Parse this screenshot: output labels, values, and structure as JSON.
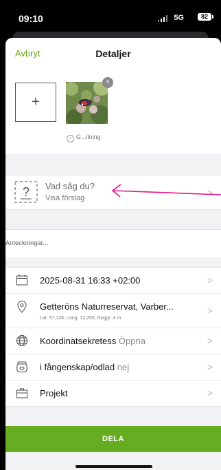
{
  "status_bar": {
    "time": "09:10",
    "network": "5G",
    "battery": "82"
  },
  "header": {
    "cancel_label": "Avbryt",
    "title": "Detaljer"
  },
  "photos": {
    "add_symbol": "+",
    "delete_symbol": "×",
    "caption": "G...llning"
  },
  "species": {
    "prompt": "Vad såg du?",
    "suggestion": "Visa förslag"
  },
  "notes": {
    "placeholder": "Anteckningar..."
  },
  "details": {
    "datetime": "2025-08-31 16:33 +02:00",
    "location": "Getteröns Naturreservat, Varber...",
    "location_coords": "Lat: 57,126, Long: 12,253, Noggr: 4 m",
    "coord_secrecy_label": "Koordinatsekretess",
    "coord_secrecy_value": "Öppna",
    "captivity_label": "i fångenskap/odlad",
    "captivity_value": "nej",
    "project_label": "Projekt"
  },
  "share_label": "DELA",
  "chevron": ">",
  "colors": {
    "accent_green": "#67ad21",
    "annotation_arrow": "#e0148a"
  },
  "icons": [
    "plus-icon",
    "close-icon",
    "check-circle-icon",
    "question-mark-icon",
    "calendar-icon",
    "location-pin-icon",
    "globe-icon",
    "jar-icon",
    "briefcase-icon",
    "chevron-right-icon",
    "arrow-left-icon"
  ]
}
